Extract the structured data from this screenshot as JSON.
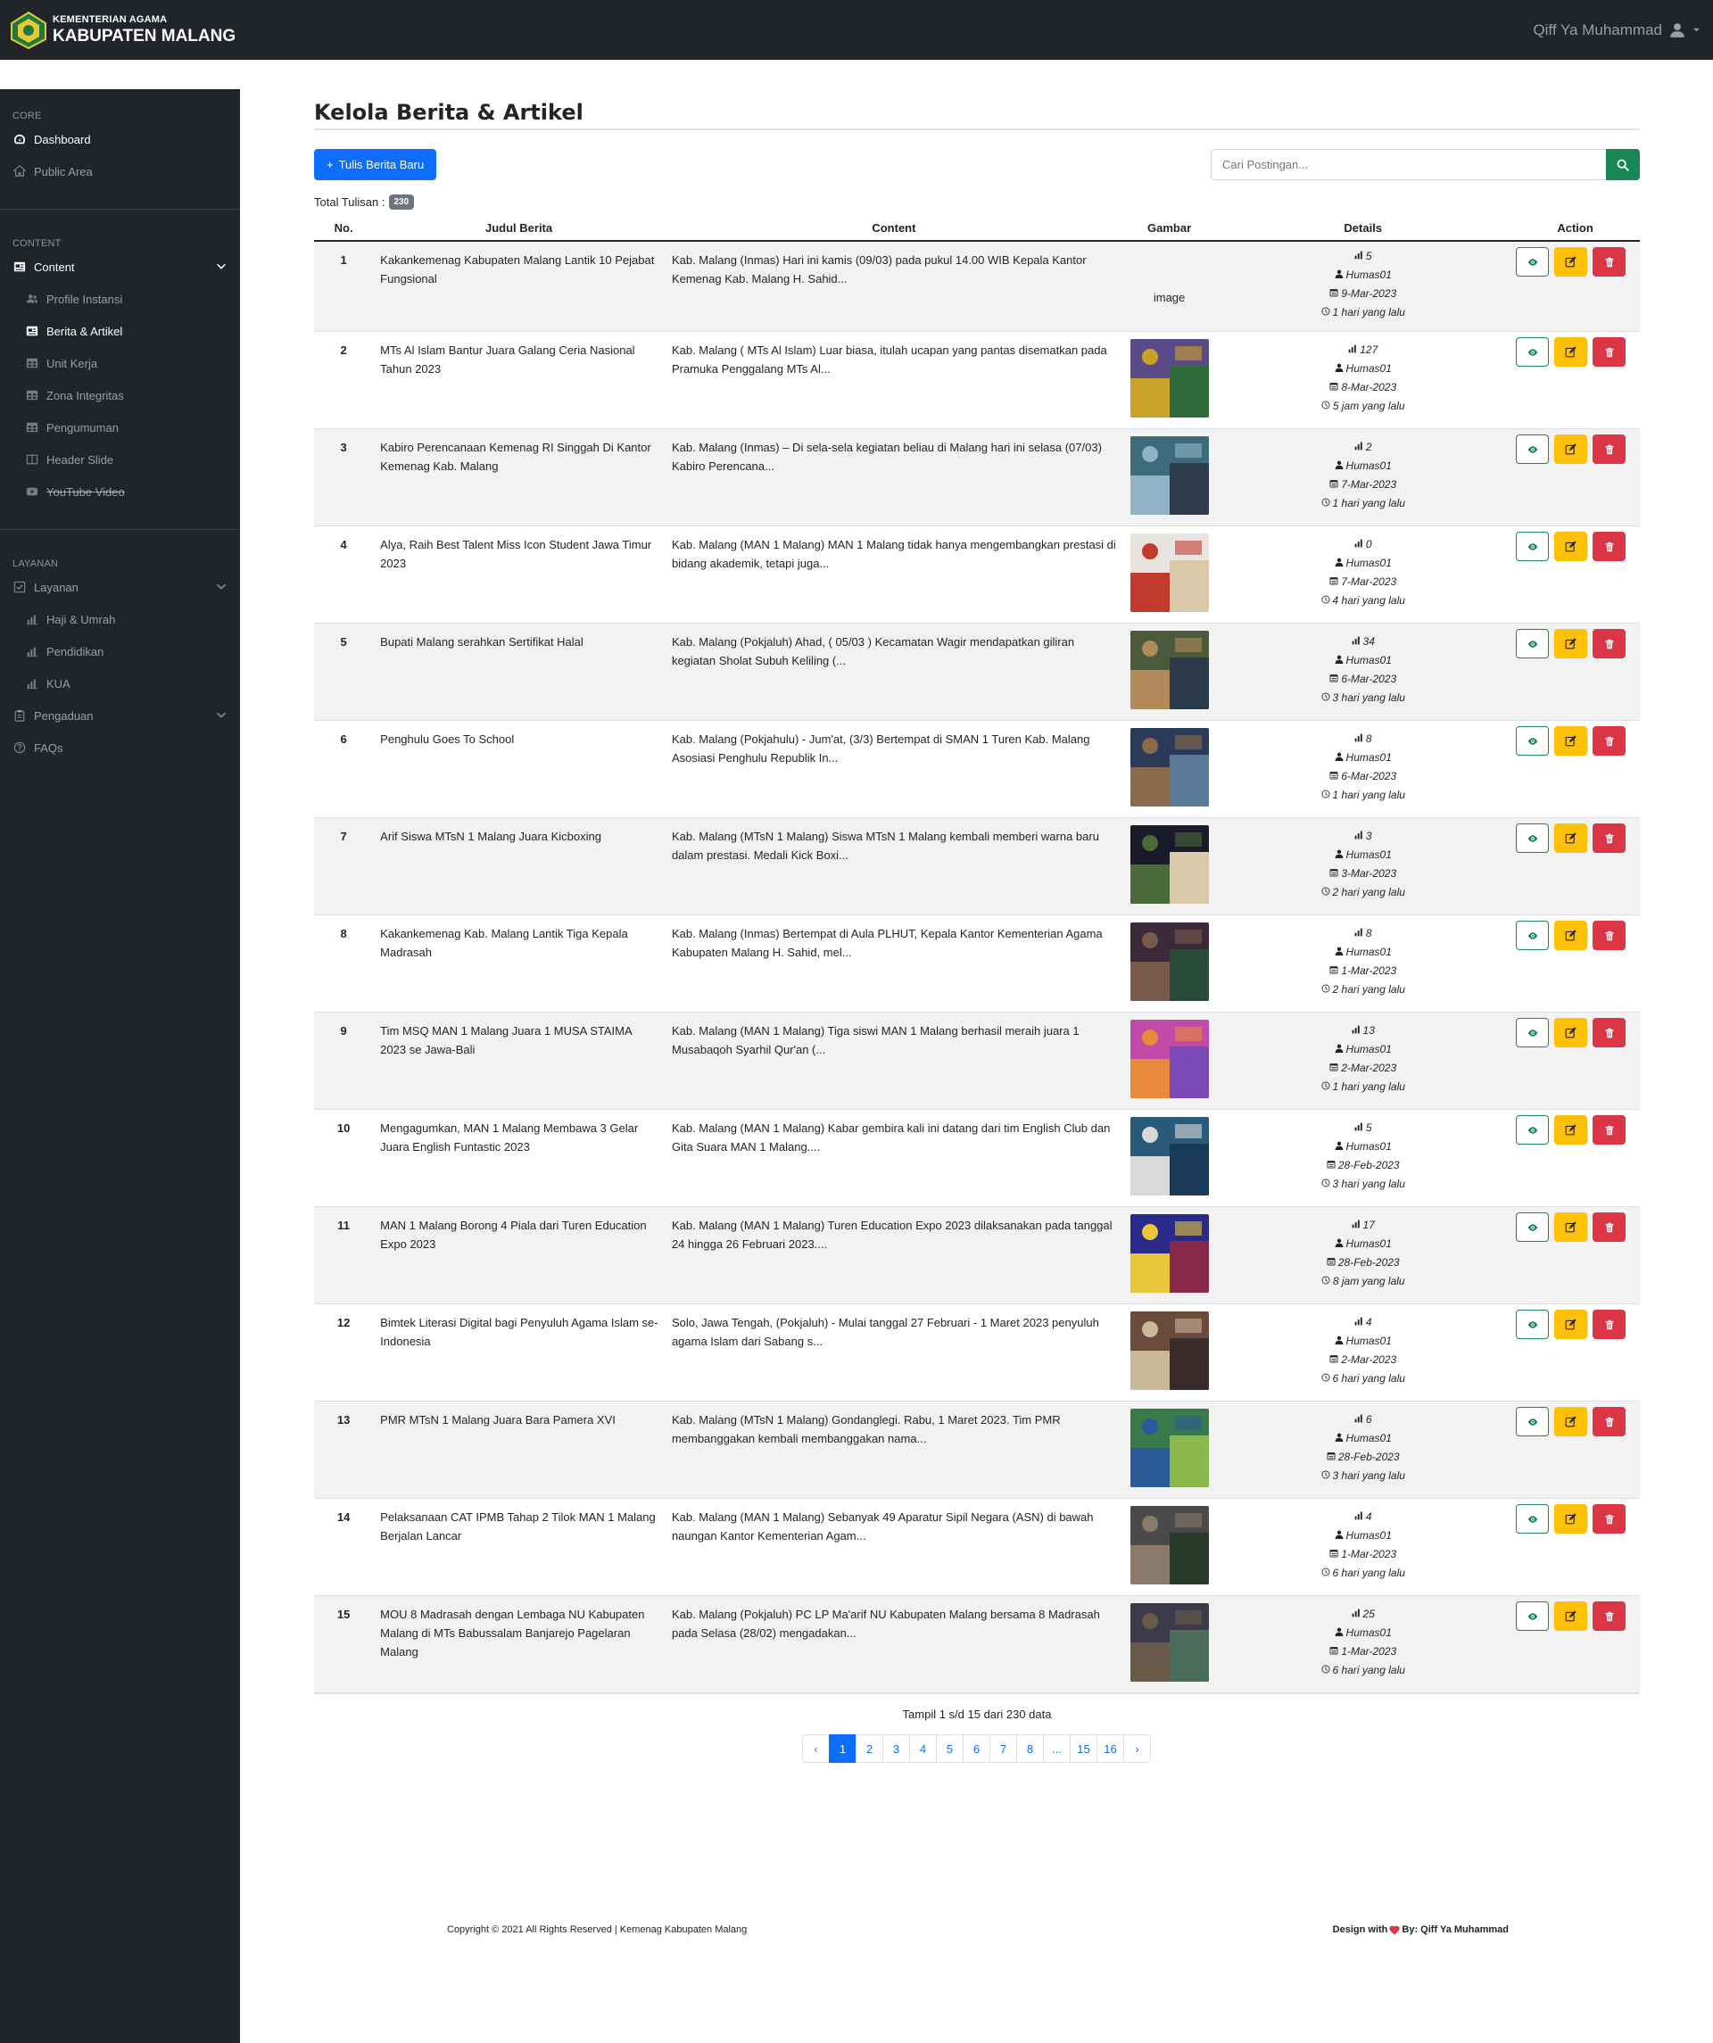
{
  "brand": {
    "line1": "KEMENTERIAN AGAMA",
    "line2": "KABUPATEN MALANG"
  },
  "user": {
    "name": "Qiff Ya Muhammad"
  },
  "sidebar": {
    "core_heading": "CORE",
    "core": [
      {
        "label": "Dashboard",
        "icon": "gauge-icon"
      },
      {
        "label": "Public Area",
        "icon": "home-icon"
      }
    ],
    "content_heading": "CONTENT",
    "content_group": "Content",
    "content_items": [
      {
        "label": "Profile Instansi",
        "icon": "users-icon"
      },
      {
        "label": "Berita & Artikel",
        "icon": "newspaper-icon"
      },
      {
        "label": "Unit Kerja",
        "icon": "table-icon"
      },
      {
        "label": "Zona Integritas",
        "icon": "table-icon"
      },
      {
        "label": "Pengumuman",
        "icon": "table-icon"
      },
      {
        "label": "Header Slide",
        "icon": "columns-icon"
      },
      {
        "label": "YouTube Video",
        "icon": "youtube-icon"
      }
    ],
    "layanan_heading": "LAYANAN",
    "layanan_group": "Layanan",
    "layanan_items": [
      {
        "label": "Haji & Umrah",
        "icon": "chart-icon"
      },
      {
        "label": "Pendidikan",
        "icon": "chart-icon"
      },
      {
        "label": "KUA",
        "icon": "chart-icon"
      }
    ],
    "pengaduan": "Pengaduan",
    "faqs": "FAQs"
  },
  "main": {
    "title": "Kelola Berita & Artikel",
    "new_button": "Tulis Berita Baru",
    "search_placeholder": "Cari Postingan...",
    "total_label": "Total Tulisan :",
    "total_count": "230",
    "columns": [
      "No.",
      "Judul Berita",
      "Content",
      "Gambar",
      "Details",
      "Action"
    ],
    "broken_image_alt": "image",
    "rows": [
      {
        "no": "1",
        "judul": "Kakankemenag Kabupaten Malang Lantik 10 Pejabat Fungsional",
        "content": "Kab. Malang (Inmas) Hari ini kamis (09/03) pada pukul 14.00 WIB Kepala Kantor Kemenag Kab. Malang H. Sahid...",
        "views": "5",
        "author": "Humas01",
        "date": "9-Mar-2023",
        "ago": "1 hari yang lalu",
        "image": null
      },
      {
        "no": "2",
        "judul": "MTs Al Islam Bantur Juara Galang Ceria Nasional Tahun 2023",
        "content": "Kab. Malang ( MTs Al Islam) Luar biasa, itulah ucapan yang pantas disematkan pada Pramuka Penggalang MTs Al...",
        "views": "127",
        "author": "Humas01",
        "date": "8-Mar-2023",
        "ago": "5 jam yang lalu",
        "image": [
          "#5a4a8a",
          "#c9a227",
          "#2f6b3a"
        ]
      },
      {
        "no": "3",
        "judul": "Kabiro Perencanaan Kemenag RI Singgah Di Kantor Kemenag Kab. Malang",
        "content": "Kab. Malang (Inmas) – Di sela-sela kegiatan beliau di Malang hari ini selasa (07/03) Kabiro Perencana...",
        "views": "2",
        "author": "Humas01",
        "date": "7-Mar-2023",
        "ago": "1 hari yang lalu",
        "image": [
          "#3d6b7a",
          "#8fb3c4",
          "#2d3b4a"
        ]
      },
      {
        "no": "4",
        "judul": "Alya, Raih Best Talent Miss Icon Student Jawa Timur 2023",
        "content": "Kab. Malang (MAN 1 Malang) MAN 1 Malang tidak hanya mengembangkan prestasi di bidang akademik, tetapi juga...",
        "views": "0",
        "author": "Humas01",
        "date": "7-Mar-2023",
        "ago": "4 hari yang lalu",
        "image": [
          "#e8e4e0",
          "#c23a2e",
          "#d9c9a8"
        ]
      },
      {
        "no": "5",
        "judul": "Bupati Malang serahkan Sertifikat Halal",
        "content": "Kab. Malang (Pokjaluh) Ahad, ( 05/03 ) Kecamatan Wagir mendapatkan giliran kegiatan Sholat Subuh Keliling (...",
        "views": "34",
        "author": "Humas01",
        "date": "6-Mar-2023",
        "ago": "3 hari yang lalu",
        "image": [
          "#4a5a3a",
          "#b08a5a",
          "#2a3a4a"
        ]
      },
      {
        "no": "6",
        "judul": "Penghulu Goes To School",
        "content": "Kab. Malang (Pokjahulu) - Jum'at, (3/3) Bertempat di SMAN 1 Turen Kab. Malang Asosiasi Penghulu Republik In...",
        "views": "8",
        "author": "Humas01",
        "date": "6-Mar-2023",
        "ago": "1 hari yang lalu",
        "image": [
          "#2a3a5a",
          "#8a6a4a",
          "#5a7a9a"
        ]
      },
      {
        "no": "7",
        "judul": "Arif Siswa MTsN 1 Malang Juara Kicboxing",
        "content": "Kab. Malang (MTsN 1 Malang) Siswa MTsN 1 Malang kembali memberi warna baru dalam prestasi. Medali Kick Boxi...",
        "views": "3",
        "author": "Humas01",
        "date": "3-Mar-2023",
        "ago": "2 hari yang lalu",
        "image": [
          "#1a1a2a",
          "#4a6a3a",
          "#d9c9a8"
        ]
      },
      {
        "no": "8",
        "judul": "Kakankemenag Kab. Malang Lantik Tiga Kepala Madrasah",
        "content": "Kab. Malang (Inmas) Bertempat di Aula PLHUT, Kepala Kantor Kementerian Agama Kabupaten Malang H. Sahid, mel...",
        "views": "8",
        "author": "Humas01",
        "date": "1-Mar-2023",
        "ago": "2 hari yang lalu",
        "image": [
          "#3a2a3a",
          "#7a5a4a",
          "#2a4a3a"
        ]
      },
      {
        "no": "9",
        "judul": "Tim MSQ MAN 1 Malang Juara 1 MUSA STAIMA 2023 se Jawa-Bali",
        "content": "Kab. Malang (MAN 1 Malang) Tiga siswi MAN 1 Malang berhasil meraih  juara 1 Musabaqoh Syarhil Qur'an (...",
        "views": "13",
        "author": "Humas01",
        "date": "2-Mar-2023",
        "ago": "1 hari yang lalu",
        "image": [
          "#c24aa8",
          "#e88a3a",
          "#7a4ab8"
        ]
      },
      {
        "no": "10",
        "judul": "Mengagumkan, MAN 1 Malang Membawa 3 Gelar Juara English Funtastic 2023",
        "content": "Kab. Malang (MAN 1 Malang) Kabar gembira kali ini datang dari tim English Club dan Gita Suara MAN 1 Malang....",
        "views": "5",
        "author": "Humas01",
        "date": "28-Feb-2023",
        "ago": "3 hari yang lalu",
        "image": [
          "#2a5a7a",
          "#d9d9d9",
          "#1a3a5a"
        ]
      },
      {
        "no": "11",
        "judul": "MAN 1 Malang Borong 4 Piala dari Turen Education Expo 2023",
        "content": "Kab. Malang (MAN 1 Malang) Turen Education Expo 2023 dilaksanakan pada tanggal 24 hingga 26 Februari 2023....",
        "views": "17",
        "author": "Humas01",
        "date": "28-Feb-2023",
        "ago": "8 jam yang lalu",
        "image": [
          "#2a2a8a",
          "#e8c83a",
          "#8a2a4a"
        ]
      },
      {
        "no": "12",
        "judul": "Bimtek Literasi Digital bagi Penyuluh Agama Islam se-Indonesia",
        "content": "Solo, Jawa Tengah, (Pokjaluh) - Mulai tanggal 27 Februari - 1 Maret 2023 penyuluh agama Islam dari Sabang s...",
        "views": "4",
        "author": "Humas01",
        "date": "2-Mar-2023",
        "ago": "6 hari yang lalu",
        "image": [
          "#6a4a3a",
          "#c9b89a",
          "#3a2a2a"
        ]
      },
      {
        "no": "13",
        "judul": "PMR MTsN 1 Malang Juara Bara Pamera XVI",
        "content": "Kab. Malang (MTsN 1 Malang) Gondanglegi. Rabu, 1 Maret 2023. Tim PMR membanggakan kembali membanggakan nama...",
        "views": "6",
        "author": "Humas01",
        "date": "28-Feb-2023",
        "ago": "3 hari yang lalu",
        "image": [
          "#3a7a4a",
          "#2a5a9a",
          "#8ab84a"
        ]
      },
      {
        "no": "14",
        "judul": "Pelaksanaan CAT IPMB Tahap 2 Tilok MAN 1 Malang Berjalan Lancar",
        "content": "Kab. Malang (MAN 1 Malang) Sebanyak 49 Aparatur Sipil Negara (ASN) di bawah naungan Kantor Kementerian Agam...",
        "views": "4",
        "author": "Humas01",
        "date": "1-Mar-2023",
        "ago": "6 hari yang lalu",
        "image": [
          "#4a4a4a",
          "#8a7a6a",
          "#2a3a2a"
        ]
      },
      {
        "no": "15",
        "judul": "MOU 8 Madrasah dengan Lembaga NU Kabupaten Malang di MTs Babussalam Banjarejo Pagelaran Malang",
        "content": "Kab. Malang (Pokjaluh) PC LP Ma'arif NU Kabupaten Malang bersama 8 Madrasah pada Selasa (28/02) mengadakan...",
        "views": "25",
        "author": "Humas01",
        "date": "1-Mar-2023",
        "ago": "6 hari yang lalu",
        "image": [
          "#3a3a4a",
          "#6a5a4a",
          "#4a6a5a"
        ]
      }
    ],
    "summary": "Tampil 1 s/d 15 dari 230 data",
    "pages": [
      "‹",
      "1",
      "2",
      "3",
      "4",
      "5",
      "6",
      "7",
      "8",
      "...",
      "15",
      "16",
      "›"
    ]
  },
  "footer": {
    "copyright": "Copyright © 2021 All Rights Reserved | Kemenag Kabupaten Malang",
    "design_prefix": "Design with",
    "design_suffix": "By: Qiff Ya Muhammad"
  },
  "colors": {
    "primary": "#0d6efd",
    "success": "#198754",
    "warning": "#ffc107",
    "danger": "#dc3545",
    "dark": "#212529"
  }
}
